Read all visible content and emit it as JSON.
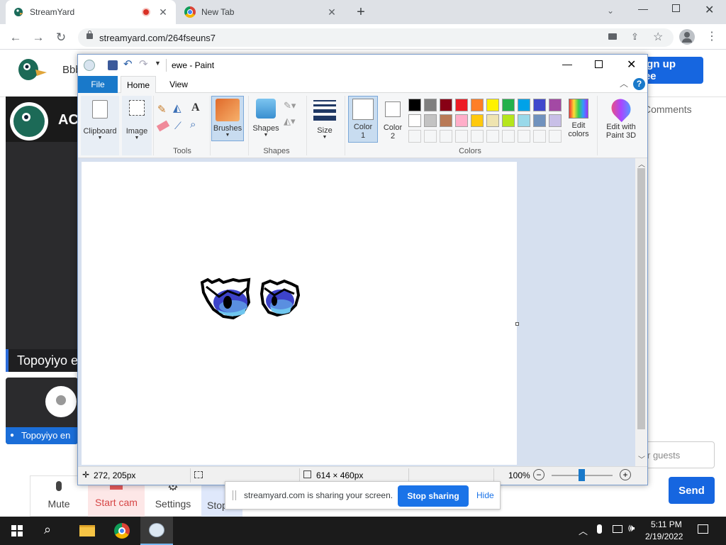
{
  "browser": {
    "tabs": [
      {
        "title": "StreamYard",
        "recording": true
      },
      {
        "title": "New Tab"
      }
    ],
    "url": "streamyard.com/264fseuns7"
  },
  "streamyard": {
    "brand_short": "Bbb",
    "signup": "Sign up free",
    "comments_tab": "Comments",
    "panel_title_partial": "AC",
    "participant_name": "Topoyiyo e",
    "participant_label": "Topoyiyo en",
    "guest_placeholder": "r guests",
    "send": "Send",
    "controls": {
      "mute": "Mute",
      "start_cam": "Start cam",
      "settings": "Settings",
      "stop": "Stop"
    }
  },
  "paint": {
    "title": "ewe - Paint",
    "menu": {
      "file": "File",
      "home": "Home",
      "view": "View"
    },
    "ribbon": {
      "clipboard": "Clipboard",
      "image": "Image",
      "tools": "Tools",
      "brushes": "Brushes",
      "shapes_btn": "Shapes",
      "shapes_group": "Shapes",
      "size": "Size",
      "color1_a": "Color",
      "color1_b": "1",
      "color2_a": "Color",
      "color2_b": "2",
      "colors_group": "Colors",
      "edit_colors_a": "Edit",
      "edit_colors_b": "colors",
      "paint3d_a": "Edit with",
      "paint3d_b": "Paint 3D"
    },
    "palette_row1": [
      "#000000",
      "#7f7f7f",
      "#880015",
      "#ed1c24",
      "#ff7f27",
      "#fff200",
      "#22b14c",
      "#00a2e8",
      "#3f48cc",
      "#a349a4"
    ],
    "palette_row2": [
      "#ffffff",
      "#c3c3c3",
      "#b97a57",
      "#ffaec9",
      "#ffc90e",
      "#efe4b0",
      "#b5e61d",
      "#99d9ea",
      "#7092be",
      "#c8bfe7"
    ],
    "status": {
      "cursor": "272, 205px",
      "size": "614 × 460px",
      "zoom": "100%"
    }
  },
  "sharing": {
    "message": "streamyard.com is sharing your screen.",
    "stop": "Stop sharing",
    "hide": "Hide"
  },
  "taskbar": {
    "time": "5:11 PM",
    "date": "2/19/2022"
  }
}
